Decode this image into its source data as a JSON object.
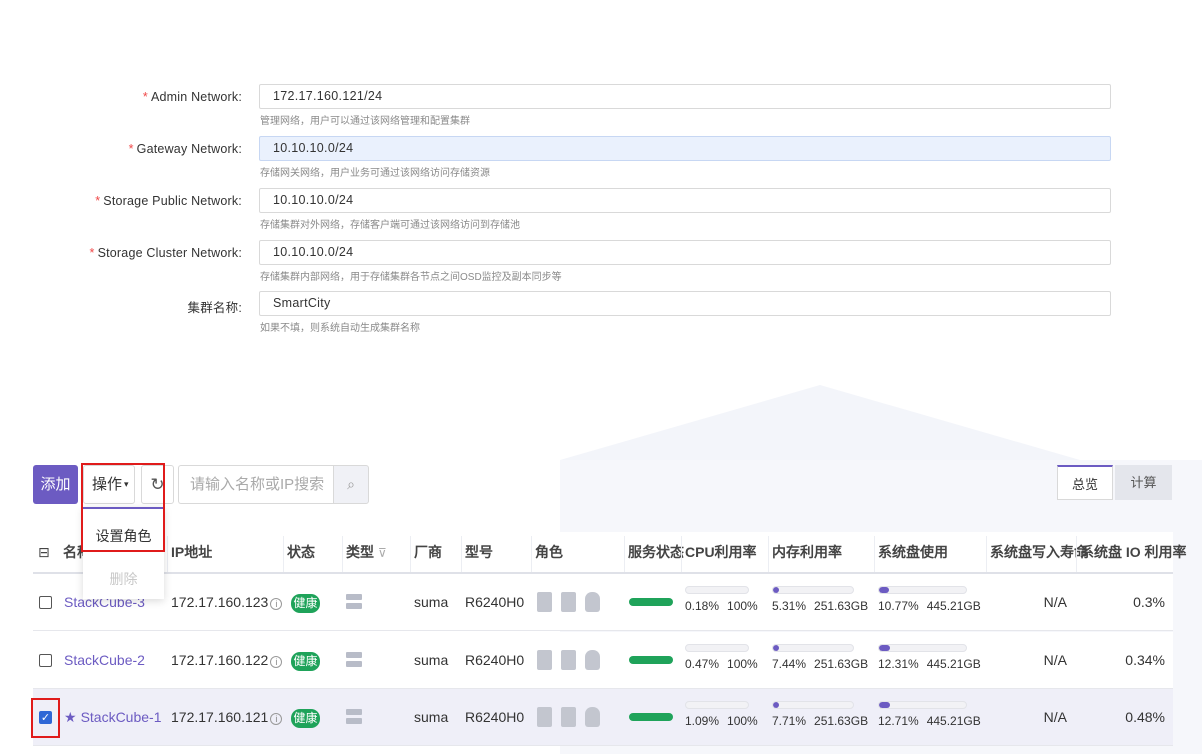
{
  "form": {
    "fields": [
      {
        "label": "Admin Network:",
        "required": true,
        "value": "172.17.160.121/24",
        "hint": "管理网络，用户可以通过该网络管理和配置集群"
      },
      {
        "label": "Gateway Network:",
        "required": true,
        "value": "10.10.10.0/24",
        "hint": "存储网关网络，用户业务可通过该网络访问存储资源"
      },
      {
        "label": "Storage Public Network:",
        "required": true,
        "value": "10.10.10.0/24",
        "hint": "存储集群对外网络，存储客户端可通过该网络访问到存储池"
      },
      {
        "label": "Storage Cluster Network:",
        "required": true,
        "value": "10.10.10.0/24",
        "hint": "存储集群内部网络，用于存储集群各节点之间OSD监控及副本同步等"
      },
      {
        "label": "集群名称:",
        "required": false,
        "value": "SmartCity",
        "hint": "如果不填，则系统自动生成集群名称"
      }
    ],
    "required_mark": "*"
  },
  "toolbar": {
    "add_label": "添加",
    "ops_label": "操作",
    "ops_caret": "▾",
    "refresh_icon": "↻",
    "search_placeholder": "请输入名称或IP搜索",
    "search_icon": "⌕"
  },
  "dropdown": {
    "items": [
      "设置角色",
      "删除"
    ]
  },
  "tabs": [
    "总览",
    "计算"
  ],
  "table": {
    "columns": [
      "名称",
      "IP地址",
      "状态",
      "类型",
      "厂商",
      "型号",
      "角色",
      "服务状态",
      "CPU利用率",
      "内存利用率",
      "系统盘使用",
      "系统盘写入寿命",
      "系统盘 IO 利用率"
    ],
    "filter_icon": "⊽",
    "select_all_icon": "⊟",
    "rows": [
      {
        "name": "StackCube-3",
        "starred": false,
        "ip": "172.17.160.123",
        "status": "健康",
        "vendor": "suma",
        "model": "R6240H0",
        "cpu": {
          "pct_text": "0.18%",
          "total": "100%",
          "fill": 0.0018
        },
        "mem": {
          "pct_text": "5.31%",
          "total": "251.63GB",
          "fill": 0.0531
        },
        "disk": {
          "pct_text": "10.77%",
          "total": "445.21GB",
          "fill": 0.1077
        },
        "life": "N/A",
        "io": "0.3%",
        "checked": false
      },
      {
        "name": "StackCube-2",
        "starred": false,
        "ip": "172.17.160.122",
        "status": "健康",
        "vendor": "suma",
        "model": "R6240H0",
        "cpu": {
          "pct_text": "0.47%",
          "total": "100%",
          "fill": 0.0047
        },
        "mem": {
          "pct_text": "7.44%",
          "total": "251.63GB",
          "fill": 0.0744
        },
        "disk": {
          "pct_text": "12.31%",
          "total": "445.21GB",
          "fill": 0.1231
        },
        "life": "N/A",
        "io": "0.34%",
        "checked": false
      },
      {
        "name": "StackCube-1",
        "starred": true,
        "ip": "172.17.160.121",
        "status": "健康",
        "vendor": "suma",
        "model": "R6240H0",
        "cpu": {
          "pct_text": "1.09%",
          "total": "100%",
          "fill": 0.0109
        },
        "mem": {
          "pct_text": "7.71%",
          "total": "251.63GB",
          "fill": 0.0771
        },
        "disk": {
          "pct_text": "12.71%",
          "total": "445.21GB",
          "fill": 0.1271
        },
        "life": "N/A",
        "io": "0.48%",
        "checked": true
      }
    ]
  },
  "colors": {
    "accent": "#6c5bc2",
    "healthy": "#1fa35a",
    "highlight": "#e01b1b",
    "required": "#f04848"
  }
}
